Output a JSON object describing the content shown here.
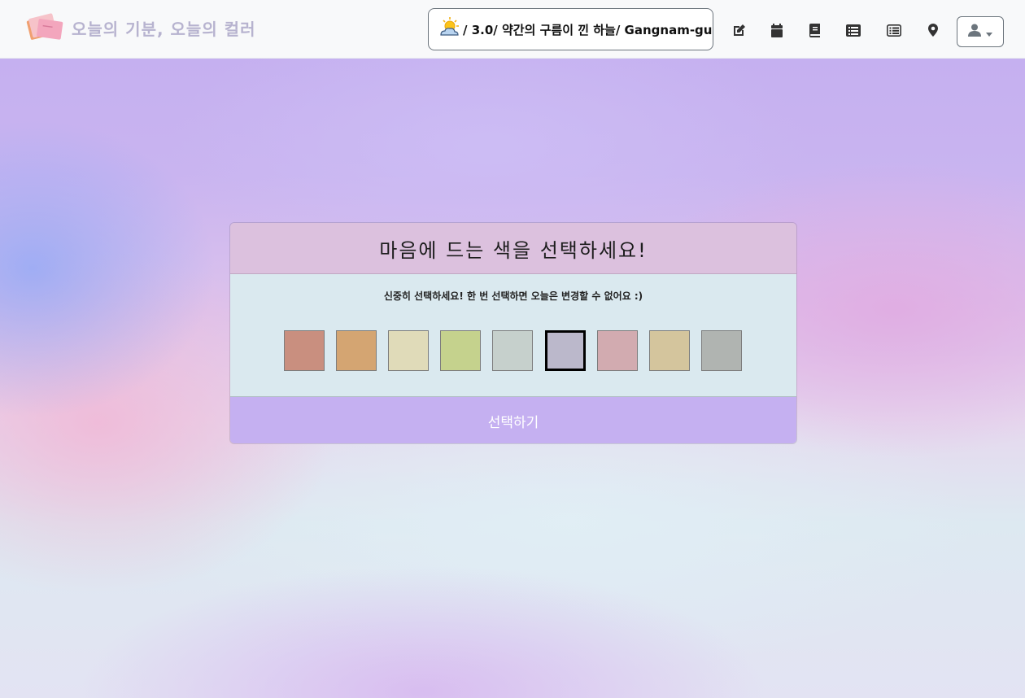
{
  "navbar": {
    "brand_title": "오늘의 기분, 오늘의 컬러",
    "brand_logo_icon": "notebook-logo-icon",
    "weather": {
      "icon": "sun-behind-cloud-icon",
      "text": "/ 3.0/ 약간의 구름이 낀 하늘/ Gangnam-gu"
    },
    "icons": [
      "edit-icon",
      "calendar-icon",
      "book-icon",
      "list-alt-icon",
      "list-icon",
      "map-marker-icon"
    ],
    "user_menu_icon": "user-icon"
  },
  "card": {
    "title": "마음에 드는 색을 선택하세요!",
    "notice": "신중히 선택하세요! 한 번 선택하면 오늘은 변경할 수 없어요 :)",
    "swatches": [
      "#c98f7f",
      "#d4a572",
      "#e0dbb9",
      "#c5d28d",
      "#c6d0cc",
      "#bbb8cb",
      "#d2abb0",
      "#d4c59d",
      "#b0b4b1"
    ],
    "selected_index": 5,
    "select_button": "선택하기"
  },
  "colors": {
    "navbar_bg": "#f8f9fa",
    "card_header_bg": "#dcc1de",
    "card_body_bg": "#dae9ef",
    "button_bg": "#c5b0f1"
  }
}
